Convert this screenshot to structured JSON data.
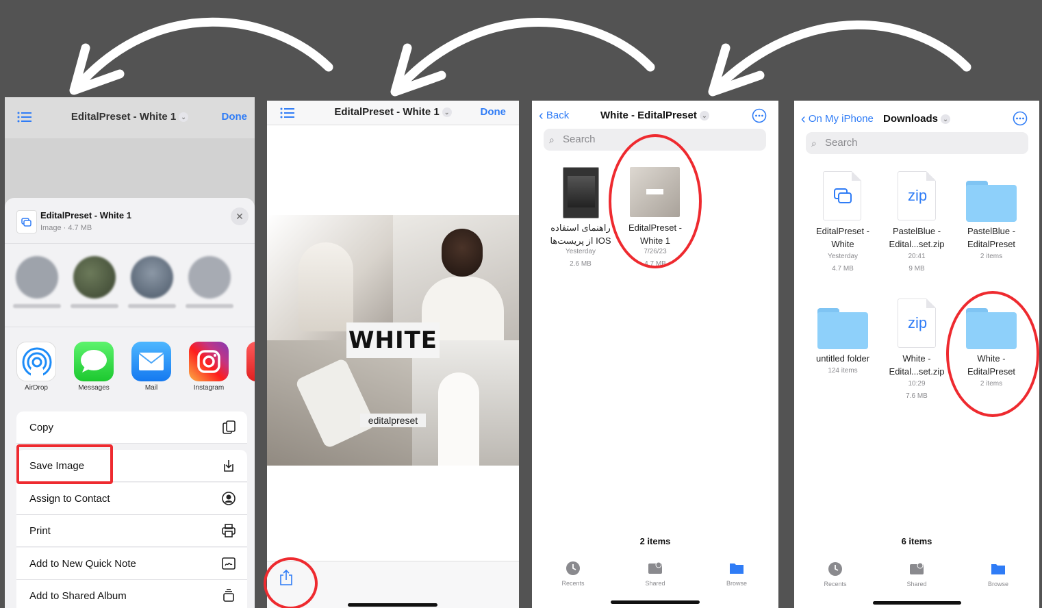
{
  "panel_share": {
    "nav_title": "EditalPreset - White 1",
    "done": "Done",
    "file_title": "EditalPreset - White 1",
    "file_meta": "Image · 4.7 MB",
    "apps": [
      {
        "label": "AirDrop"
      },
      {
        "label": "Messages"
      },
      {
        "label": "Mail"
      },
      {
        "label": "Instagram"
      }
    ],
    "actions": [
      {
        "label": "Copy",
        "icon": "copy-icon"
      },
      {
        "label": "Save Image",
        "icon": "save-image-icon"
      },
      {
        "label": "Assign to Contact",
        "icon": "contact-icon"
      },
      {
        "label": "Print",
        "icon": "printer-icon"
      },
      {
        "label": "Add to New Quick Note",
        "icon": "quick-note-icon"
      },
      {
        "label": "Add to Shared Album",
        "icon": "shared-album-icon"
      }
    ]
  },
  "panel_preview": {
    "nav_title": "EditalPreset - White 1",
    "done": "Done",
    "image_word": "WHITE",
    "image_handle": "editalpreset"
  },
  "panel_folder": {
    "back": "Back",
    "title": "White - EditalPreset",
    "search_placeholder": "Search",
    "files": [
      {
        "name_line1": "راهنمای استفاده",
        "name_line2": "از پریست‌ها IOS",
        "meta1": "Yesterday",
        "meta2": "2.6 MB"
      },
      {
        "name_line1": "EditalPreset -",
        "name_line2": "White 1",
        "meta1": "7/26/23",
        "meta2": "4.7 MB"
      }
    ],
    "count": "2 items",
    "tabs": [
      "Recents",
      "Shared",
      "Browse"
    ]
  },
  "panel_downloads": {
    "back": "On My iPhone",
    "title": "Downloads",
    "search_placeholder": "Search",
    "items": [
      {
        "name_line1": "EditalPreset -",
        "name_line2": "White",
        "meta1": "Yesterday",
        "meta2": "4.7 MB",
        "kind": "file"
      },
      {
        "name_line1": "PastelBlue -",
        "name_line2": "Edital...set.zip",
        "meta1": "20:41",
        "meta2": "9 MB",
        "kind": "zip"
      },
      {
        "name_line1": "PastelBlue -",
        "name_line2": "EditalPreset",
        "meta1": "2 items",
        "meta2": "",
        "kind": "folder"
      },
      {
        "name_line1": "untitled folder",
        "name_line2": "",
        "meta1": "124 items",
        "meta2": "",
        "kind": "folder"
      },
      {
        "name_line1": "White -",
        "name_line2": "Edital...set.zip",
        "meta1": "10:29",
        "meta2": "7.6 MB",
        "kind": "zip"
      },
      {
        "name_line1": "White -",
        "name_line2": "EditalPreset",
        "meta1": "2 items",
        "meta2": "",
        "kind": "folder"
      }
    ],
    "zip_label": "zip",
    "count": "6 items",
    "tabs": [
      "Recents",
      "Shared",
      "Browse"
    ]
  },
  "colors": {
    "background": "#535353",
    "accent": "#2f7cf6",
    "highlight": "#ee2a2f"
  }
}
